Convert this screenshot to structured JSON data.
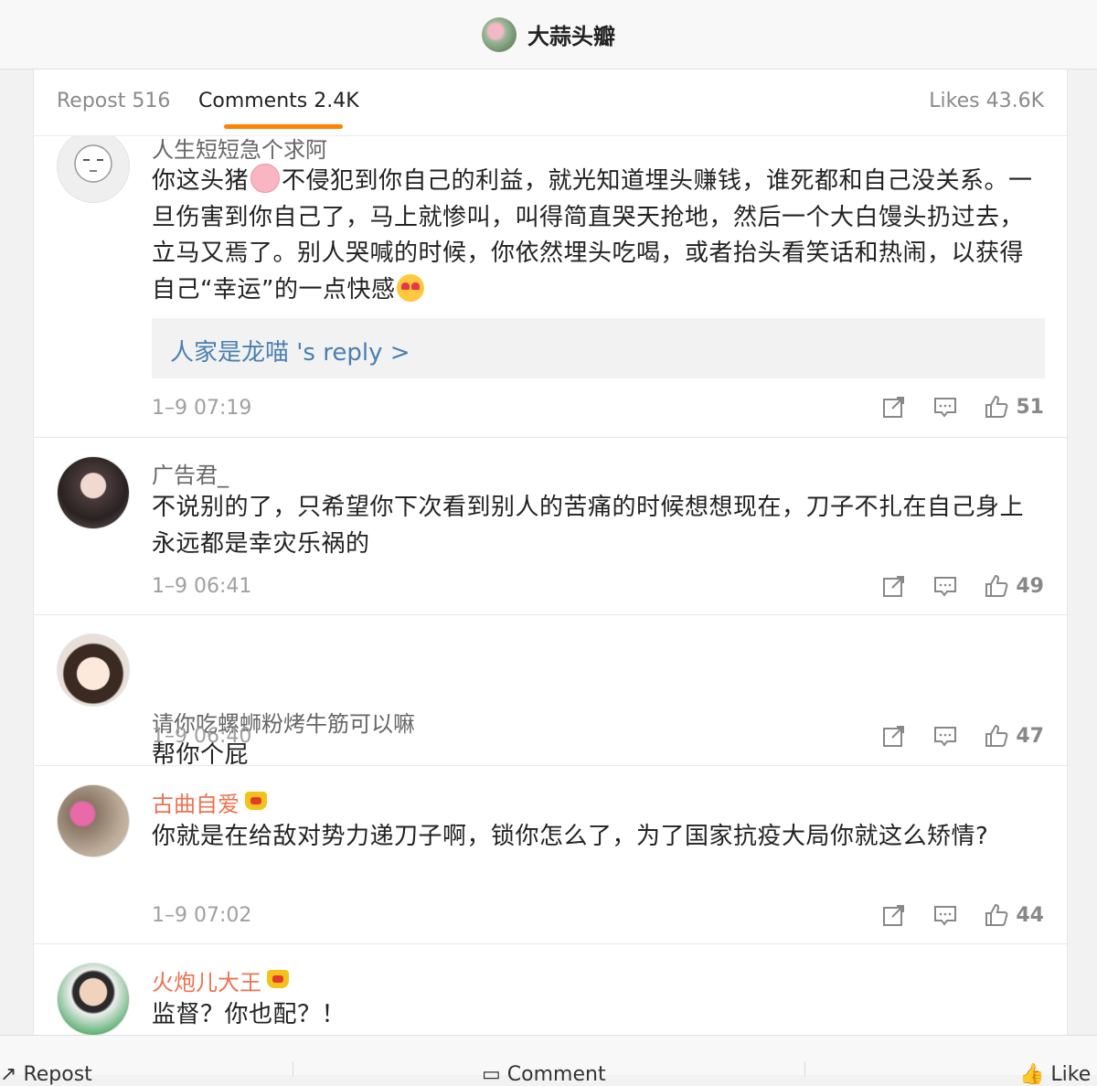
{
  "header": {
    "title": "大蒜头瓣"
  },
  "tabs": {
    "repost": "Repost 516",
    "comments": "Comments 2.4K",
    "likes": "Likes 43.6K"
  },
  "colors": {
    "accent": "#ff8200",
    "link": "#4a7fb0",
    "vip_name": "#eb7350"
  },
  "comments": [
    {
      "user": "人生短短急个求阿",
      "text_before_emoji": "你这头猪",
      "text_after_emoji": "不侵犯到你自己的利益，就光知道埋头赚钱，谁死都和自己没关系。一旦伤害到你自己了，马上就惨叫，叫得简直哭天抢地，然后一个大白馒头扔过去，立马又焉了。别人哭喊的时候，你依然埋头吃喝，或者抬头看笑话和热闹，以获得自己“幸运”的一点快感",
      "reply_link": "人家是龙喵  's reply >",
      "time": "1–9 07:19",
      "likes": "51"
    },
    {
      "user": "广告君_",
      "text": "不说别的了，只希望你下次看到别人的苦痛的时候想想现在，刀子不扎在自己身上永远都是幸灾乐祸的",
      "time": "1–9 06:41",
      "likes": "49"
    },
    {
      "user": "请你吃螺蛳粉烤牛筋可以嘛",
      "text": "帮你个屁",
      "time": "1–9 06:40",
      "likes": "47"
    },
    {
      "user": "古曲自爱",
      "text": "你就是在给敌对势力递刀子啊，锁你怎么了，为了国家抗疫大局你就这么矫情?",
      "time": "1–9 07:02",
      "likes": "44"
    },
    {
      "user": "火炮儿大王",
      "text": "监督？你也配？！"
    }
  ],
  "bottom_bar": {
    "repost": "Repost",
    "comment": "Comment",
    "like": "Like"
  }
}
